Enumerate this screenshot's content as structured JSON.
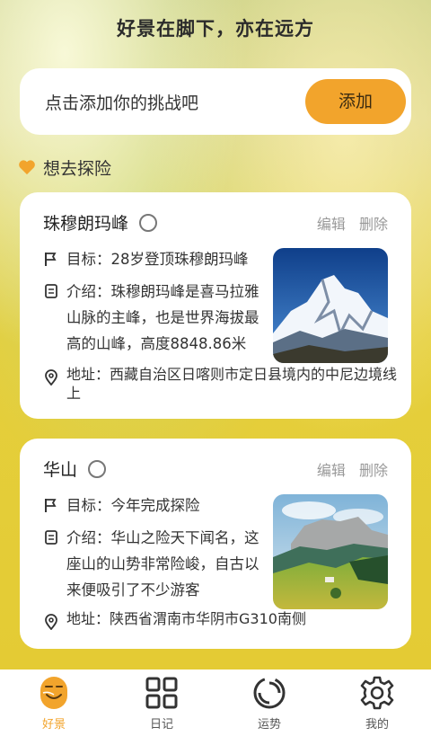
{
  "header": {
    "title": "好景在脚下，亦在远方"
  },
  "add_challenge": {
    "placeholder": "点击添加你的挑战吧",
    "button_label": "添加"
  },
  "section": {
    "title": "想去探险",
    "icon": "heart-icon",
    "icon_color": "#f2a42c"
  },
  "cards": [
    {
      "title": "珠穆朗玛峰",
      "edit_label": "编辑",
      "delete_label": "删除",
      "goal": "目标：28岁登顶珠穆朗玛峰",
      "intro": "介绍：珠穆朗玛峰是喜马拉雅山脉的主峰，也是世界海拔最高的山峰，高度8848.86米",
      "address": "地址：西藏自治区日喀则市定日县境内的中尼边境线上",
      "image": "snow-mountain"
    },
    {
      "title": "华山",
      "edit_label": "编辑",
      "delete_label": "删除",
      "goal": "目标：今年完成探险",
      "intro": "介绍：华山之险天下闻名，这座山的山势非常险峻，自古以来便吸引了不少游客",
      "address": "地址：陕西省渭南市华阴市G310南侧",
      "image": "green-valley"
    }
  ],
  "tabbar": [
    {
      "label": "好景",
      "icon": "scenery-icon",
      "active": true
    },
    {
      "label": "日记",
      "icon": "grid-icon",
      "active": false
    },
    {
      "label": "运势",
      "icon": "fortune-icon",
      "active": false
    },
    {
      "label": "我的",
      "icon": "gear-icon",
      "active": false
    }
  ],
  "colors": {
    "accent": "#f2a42c",
    "background": "#e5cf3c"
  }
}
